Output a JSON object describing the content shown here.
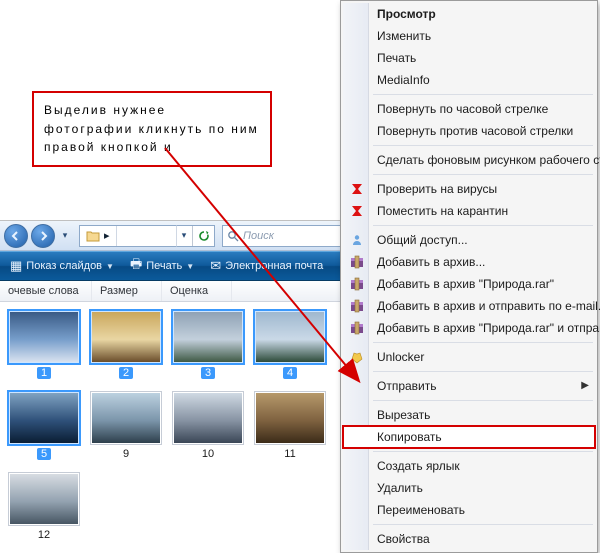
{
  "callout": {
    "text": "Выделив нужнее фотографии кликнуть по ним правой кнопкой и"
  },
  "explorer": {
    "toolbar": {
      "slideshow": "Показ слайдов",
      "print": "Печать",
      "email": "Электронная почта"
    },
    "search": {
      "placeholder": "Поиск"
    },
    "columns": {
      "tags": "очевые слова",
      "size": "Размер",
      "rating": "Оценка"
    },
    "items": [
      {
        "label": "1",
        "selected": true,
        "grad": [
          "#3a5b86",
          "#779ecb",
          "#d8e2ef"
        ]
      },
      {
        "label": "2",
        "selected": true,
        "grad": [
          "#caa75d",
          "#e9d6a3",
          "#6b4e2b"
        ]
      },
      {
        "label": "3",
        "selected": true,
        "grad": [
          "#8fa2b5",
          "#c3d0dc",
          "#3f5a45"
        ]
      },
      {
        "label": "4",
        "selected": true,
        "grad": [
          "#9fb8cf",
          "#cad9e7",
          "#2d4b3a"
        ]
      },
      {
        "label": "5",
        "selected": true,
        "grad": [
          "#7fa2c1",
          "#2f517a",
          "#0a1d33"
        ]
      },
      {
        "label": "9",
        "selected": false,
        "grad": [
          "#bcd1e0",
          "#7b95aa",
          "#2d3f4c"
        ]
      },
      {
        "label": "10",
        "selected": false,
        "grad": [
          "#cfd9e3",
          "#8793a3",
          "#3a4656"
        ]
      },
      {
        "label": "11",
        "selected": false,
        "grad": [
          "#b6996b",
          "#7f6240",
          "#3b2b18"
        ]
      },
      {
        "label": "12",
        "selected": false,
        "grad": [
          "#d7dce2",
          "#93a2b0",
          "#475663"
        ]
      }
    ]
  },
  "menu": {
    "items": [
      {
        "label": "Просмотр",
        "bold": true
      },
      {
        "label": "Изменить"
      },
      {
        "label": "Печать"
      },
      {
        "label": "MediaInfo"
      },
      {
        "sep": true
      },
      {
        "label": "Повернуть по часовой стрелке"
      },
      {
        "label": "Повернуть против часовой стрелки"
      },
      {
        "sep": true
      },
      {
        "label": "Сделать фоновым рисунком рабочего стола"
      },
      {
        "sep": true
      },
      {
        "label": "Проверить на вирусы",
        "icon": "kav-scan"
      },
      {
        "label": "Поместить на карантин",
        "icon": "kav-quarantine"
      },
      {
        "sep": true
      },
      {
        "label": "Общий доступ...",
        "icon": "share"
      },
      {
        "label": "Добавить в архив...",
        "icon": "winrar"
      },
      {
        "label": "Добавить в архив \"Природа.rar\"",
        "icon": "winrar"
      },
      {
        "label": "Добавить в архив и отправить по e-mail...",
        "icon": "winrar"
      },
      {
        "label": "Добавить в архив \"Природа.rar\" и отправить по e-mail",
        "icon": "winrar"
      },
      {
        "sep": true
      },
      {
        "label": "Unlocker",
        "icon": "unlocker"
      },
      {
        "sep": true
      },
      {
        "label": "Отправить",
        "submenu": true
      },
      {
        "sep": true
      },
      {
        "label": "Вырезать"
      },
      {
        "label": "Копировать",
        "highlight": true
      },
      {
        "sep": true
      },
      {
        "label": "Создать ярлык"
      },
      {
        "label": "Удалить"
      },
      {
        "label": "Переименовать"
      },
      {
        "sep": true
      },
      {
        "label": "Свойства"
      }
    ]
  }
}
